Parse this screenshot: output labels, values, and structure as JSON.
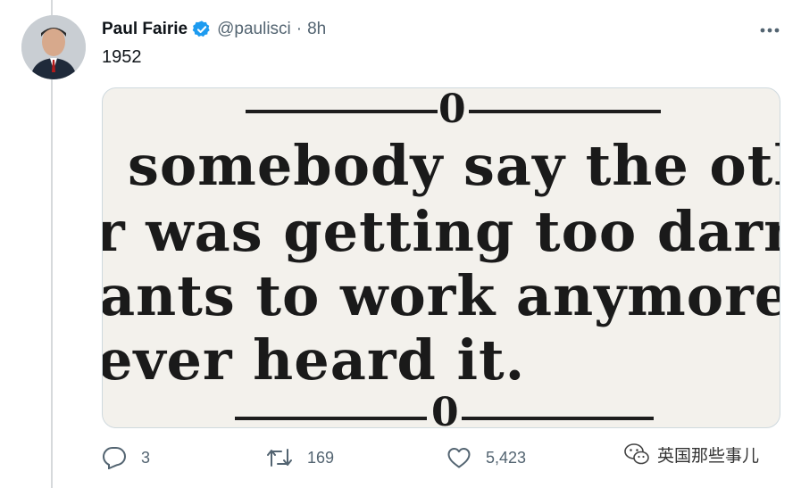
{
  "tweet": {
    "author_name": "Paul Fairie",
    "handle": "@paulisci",
    "separator": "·",
    "time": "8h",
    "text": "1952"
  },
  "clipping": {
    "lines": [
      "somebody say the othe",
      "r was getting too darne",
      "ants to work anymore.",
      "ever heard it."
    ],
    "rule_mark": "0"
  },
  "actions": {
    "reply_count": "3",
    "retweet_count": "169",
    "like_count": "5,423"
  },
  "watermark": {
    "text": "英国那些事儿"
  },
  "colors": {
    "verified": "#1d9bf0",
    "muted": "#536471"
  }
}
